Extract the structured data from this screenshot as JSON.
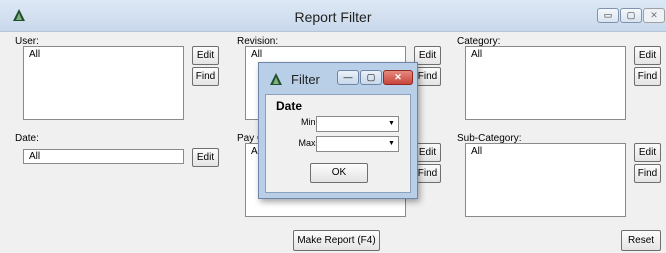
{
  "window": {
    "title": "Report Filter",
    "controls": {
      "minimize": "▭",
      "maximize": "▢",
      "close": "✕"
    }
  },
  "panels": {
    "user": {
      "label": "User:",
      "value": "All",
      "edit": "Edit",
      "find": "Find"
    },
    "revision": {
      "label": "Revision:",
      "value": "All",
      "edit": "Edit",
      "find": "Find"
    },
    "category": {
      "label": "Category:",
      "value": "All",
      "edit": "Edit",
      "find": "Find"
    },
    "date": {
      "label": "Date:",
      "value": "All",
      "edit": "Edit"
    },
    "pay": {
      "label": "Pay C",
      "value": "Al",
      "edit": "Edit",
      "find": "Find"
    },
    "subcategory": {
      "label": "Sub-Category:",
      "value": "All",
      "edit": "Edit",
      "find": "Find"
    }
  },
  "buttons": {
    "make_report": "Make Report (F4)",
    "reset": "Reset"
  },
  "dialog": {
    "title": "Filter",
    "heading": "Date",
    "min_label": "Min:",
    "max_label": "Max:",
    "min_value": "",
    "max_value": "",
    "ok": "OK",
    "controls": {
      "minimize": "—",
      "maximize": "▢",
      "close": "✕"
    }
  },
  "colors": {
    "dialog_close": "#c9453b",
    "titlebar": "#dde8f4",
    "dialog_frame": "#b9cfe8"
  }
}
